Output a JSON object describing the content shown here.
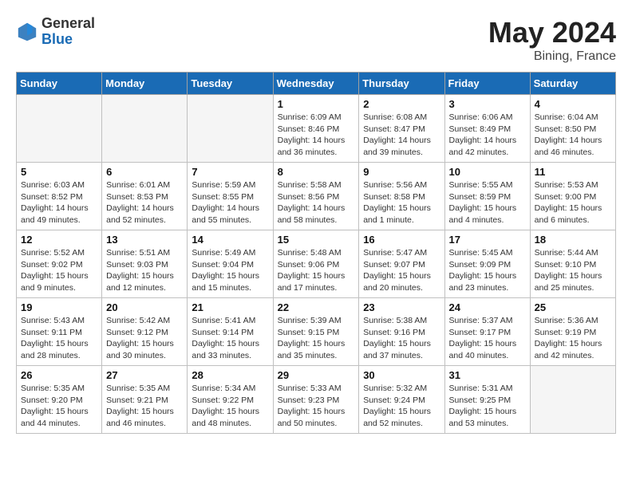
{
  "header": {
    "logo_general": "General",
    "logo_blue": "Blue",
    "month_year": "May 2024",
    "location": "Bining, France"
  },
  "weekdays": [
    "Sunday",
    "Monday",
    "Tuesday",
    "Wednesday",
    "Thursday",
    "Friday",
    "Saturday"
  ],
  "weeks": [
    [
      {
        "day": "",
        "info": ""
      },
      {
        "day": "",
        "info": ""
      },
      {
        "day": "",
        "info": ""
      },
      {
        "day": "1",
        "info": "Sunrise: 6:09 AM\nSunset: 8:46 PM\nDaylight: 14 hours\nand 36 minutes."
      },
      {
        "day": "2",
        "info": "Sunrise: 6:08 AM\nSunset: 8:47 PM\nDaylight: 14 hours\nand 39 minutes."
      },
      {
        "day": "3",
        "info": "Sunrise: 6:06 AM\nSunset: 8:49 PM\nDaylight: 14 hours\nand 42 minutes."
      },
      {
        "day": "4",
        "info": "Sunrise: 6:04 AM\nSunset: 8:50 PM\nDaylight: 14 hours\nand 46 minutes."
      }
    ],
    [
      {
        "day": "5",
        "info": "Sunrise: 6:03 AM\nSunset: 8:52 PM\nDaylight: 14 hours\nand 49 minutes."
      },
      {
        "day": "6",
        "info": "Sunrise: 6:01 AM\nSunset: 8:53 PM\nDaylight: 14 hours\nand 52 minutes."
      },
      {
        "day": "7",
        "info": "Sunrise: 5:59 AM\nSunset: 8:55 PM\nDaylight: 14 hours\nand 55 minutes."
      },
      {
        "day": "8",
        "info": "Sunrise: 5:58 AM\nSunset: 8:56 PM\nDaylight: 14 hours\nand 58 minutes."
      },
      {
        "day": "9",
        "info": "Sunrise: 5:56 AM\nSunset: 8:58 PM\nDaylight: 15 hours\nand 1 minute."
      },
      {
        "day": "10",
        "info": "Sunrise: 5:55 AM\nSunset: 8:59 PM\nDaylight: 15 hours\nand 4 minutes."
      },
      {
        "day": "11",
        "info": "Sunrise: 5:53 AM\nSunset: 9:00 PM\nDaylight: 15 hours\nand 6 minutes."
      }
    ],
    [
      {
        "day": "12",
        "info": "Sunrise: 5:52 AM\nSunset: 9:02 PM\nDaylight: 15 hours\nand 9 minutes."
      },
      {
        "day": "13",
        "info": "Sunrise: 5:51 AM\nSunset: 9:03 PM\nDaylight: 15 hours\nand 12 minutes."
      },
      {
        "day": "14",
        "info": "Sunrise: 5:49 AM\nSunset: 9:04 PM\nDaylight: 15 hours\nand 15 minutes."
      },
      {
        "day": "15",
        "info": "Sunrise: 5:48 AM\nSunset: 9:06 PM\nDaylight: 15 hours\nand 17 minutes."
      },
      {
        "day": "16",
        "info": "Sunrise: 5:47 AM\nSunset: 9:07 PM\nDaylight: 15 hours\nand 20 minutes."
      },
      {
        "day": "17",
        "info": "Sunrise: 5:45 AM\nSunset: 9:09 PM\nDaylight: 15 hours\nand 23 minutes."
      },
      {
        "day": "18",
        "info": "Sunrise: 5:44 AM\nSunset: 9:10 PM\nDaylight: 15 hours\nand 25 minutes."
      }
    ],
    [
      {
        "day": "19",
        "info": "Sunrise: 5:43 AM\nSunset: 9:11 PM\nDaylight: 15 hours\nand 28 minutes."
      },
      {
        "day": "20",
        "info": "Sunrise: 5:42 AM\nSunset: 9:12 PM\nDaylight: 15 hours\nand 30 minutes."
      },
      {
        "day": "21",
        "info": "Sunrise: 5:41 AM\nSunset: 9:14 PM\nDaylight: 15 hours\nand 33 minutes."
      },
      {
        "day": "22",
        "info": "Sunrise: 5:39 AM\nSunset: 9:15 PM\nDaylight: 15 hours\nand 35 minutes."
      },
      {
        "day": "23",
        "info": "Sunrise: 5:38 AM\nSunset: 9:16 PM\nDaylight: 15 hours\nand 37 minutes."
      },
      {
        "day": "24",
        "info": "Sunrise: 5:37 AM\nSunset: 9:17 PM\nDaylight: 15 hours\nand 40 minutes."
      },
      {
        "day": "25",
        "info": "Sunrise: 5:36 AM\nSunset: 9:19 PM\nDaylight: 15 hours\nand 42 minutes."
      }
    ],
    [
      {
        "day": "26",
        "info": "Sunrise: 5:35 AM\nSunset: 9:20 PM\nDaylight: 15 hours\nand 44 minutes."
      },
      {
        "day": "27",
        "info": "Sunrise: 5:35 AM\nSunset: 9:21 PM\nDaylight: 15 hours\nand 46 minutes."
      },
      {
        "day": "28",
        "info": "Sunrise: 5:34 AM\nSunset: 9:22 PM\nDaylight: 15 hours\nand 48 minutes."
      },
      {
        "day": "29",
        "info": "Sunrise: 5:33 AM\nSunset: 9:23 PM\nDaylight: 15 hours\nand 50 minutes."
      },
      {
        "day": "30",
        "info": "Sunrise: 5:32 AM\nSunset: 9:24 PM\nDaylight: 15 hours\nand 52 minutes."
      },
      {
        "day": "31",
        "info": "Sunrise: 5:31 AM\nSunset: 9:25 PM\nDaylight: 15 hours\nand 53 minutes."
      },
      {
        "day": "",
        "info": ""
      }
    ]
  ]
}
